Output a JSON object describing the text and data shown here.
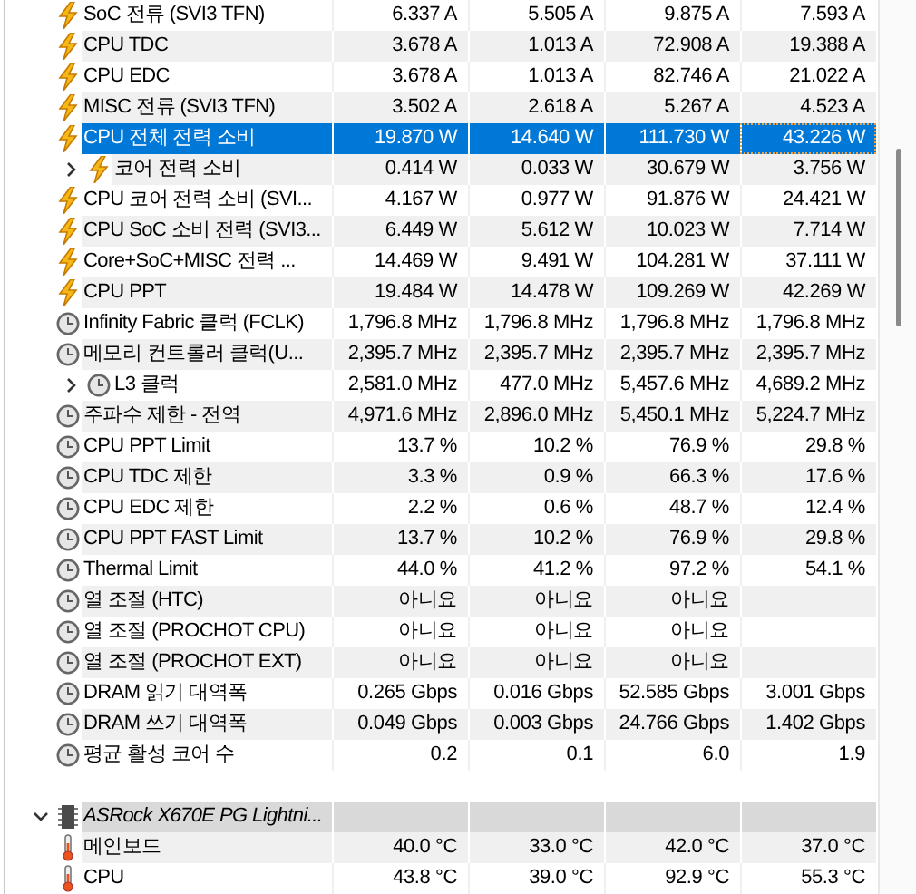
{
  "rows": [
    {
      "kind": "power",
      "name": "SoC 전류 (SVI3 TFN)",
      "selected": false,
      "values": [
        "6.337 A",
        "5.505 A",
        "9.875 A",
        "7.593 A"
      ]
    },
    {
      "kind": "power",
      "name": "CPU TDC",
      "selected": false,
      "values": [
        "3.678 A",
        "1.013 A",
        "72.908 A",
        "19.388 A"
      ]
    },
    {
      "kind": "power",
      "name": "CPU EDC",
      "selected": false,
      "values": [
        "3.678 A",
        "1.013 A",
        "82.746 A",
        "21.022 A"
      ]
    },
    {
      "kind": "power",
      "name": "MISC 전류 (SVI3 TFN)",
      "selected": false,
      "values": [
        "3.502 A",
        "2.618 A",
        "5.267 A",
        "4.523 A"
      ]
    },
    {
      "kind": "power",
      "name": "CPU 전체 전력 소비",
      "selected": true,
      "values": [
        "19.870 W",
        "14.640 W",
        "111.730 W",
        "43.226 W"
      ]
    },
    {
      "kind": "power",
      "name": "코어 전력 소비",
      "selected": false,
      "expanded": false,
      "values": [
        "0.414 W",
        "0.033 W",
        "30.679 W",
        "3.756 W"
      ]
    },
    {
      "kind": "power",
      "name": "CPU 코어 전력 소비 (SVI...",
      "selected": false,
      "values": [
        "4.167 W",
        "0.977 W",
        "91.876 W",
        "24.421 W"
      ]
    },
    {
      "kind": "power",
      "name": "CPU SoC 소비 전력 (SVI3...",
      "selected": false,
      "values": [
        "6.449 W",
        "5.612 W",
        "10.023 W",
        "7.714 W"
      ]
    },
    {
      "kind": "power",
      "name": "Core+SoC+MISC 전력 ...",
      "selected": false,
      "values": [
        "14.469 W",
        "9.491 W",
        "104.281 W",
        "37.111 W"
      ]
    },
    {
      "kind": "power",
      "name": "CPU PPT",
      "selected": false,
      "values": [
        "19.484 W",
        "14.478 W",
        "109.269 W",
        "42.269 W"
      ]
    },
    {
      "kind": "clock",
      "name": "Infinity Fabric 클럭 (FCLK)",
      "selected": false,
      "values": [
        "1,796.8 MHz",
        "1,796.8 MHz",
        "1,796.8 MHz",
        "1,796.8 MHz"
      ]
    },
    {
      "kind": "clock",
      "name": "메모리 컨트롤러 클럭(U...",
      "selected": false,
      "values": [
        "2,395.7 MHz",
        "2,395.7 MHz",
        "2,395.7 MHz",
        "2,395.7 MHz"
      ]
    },
    {
      "kind": "clock",
      "name": "L3 클럭",
      "selected": false,
      "expanded": false,
      "values": [
        "2,581.0 MHz",
        "477.0 MHz",
        "5,457.6 MHz",
        "4,689.2 MHz"
      ]
    },
    {
      "kind": "clock",
      "name": "주파수 제한 - 전역",
      "selected": false,
      "values": [
        "4,971.6 MHz",
        "2,896.0 MHz",
        "5,450.1 MHz",
        "5,224.7 MHz"
      ]
    },
    {
      "kind": "clock",
      "name": "CPU PPT Limit",
      "selected": false,
      "values": [
        "13.7 %",
        "10.2 %",
        "76.9 %",
        "29.8 %"
      ]
    },
    {
      "kind": "clock",
      "name": "CPU TDC 제한",
      "selected": false,
      "values": [
        "3.3 %",
        "0.9 %",
        "66.3 %",
        "17.6 %"
      ]
    },
    {
      "kind": "clock",
      "name": "CPU EDC 제한",
      "selected": false,
      "values": [
        "2.2 %",
        "0.6 %",
        "48.7 %",
        "12.4 %"
      ]
    },
    {
      "kind": "clock",
      "name": "CPU PPT FAST Limit",
      "selected": false,
      "values": [
        "13.7 %",
        "10.2 %",
        "76.9 %",
        "29.8 %"
      ]
    },
    {
      "kind": "clock",
      "name": "Thermal Limit",
      "selected": false,
      "values": [
        "44.0 %",
        "41.2 %",
        "97.2 %",
        "54.1 %"
      ]
    },
    {
      "kind": "clock",
      "name": "열 조절 (HTC)",
      "selected": false,
      "values": [
        "아니요",
        "아니요",
        "아니요"
      ]
    },
    {
      "kind": "clock",
      "name": "열 조절 (PROCHOT CPU)",
      "selected": false,
      "values": [
        "아니요",
        "아니요",
        "아니요"
      ]
    },
    {
      "kind": "clock",
      "name": "열 조절 (PROCHOT EXT)",
      "selected": false,
      "values": [
        "아니요",
        "아니요",
        "아니요"
      ]
    },
    {
      "kind": "clock",
      "name": "DRAM 읽기 대역폭",
      "selected": false,
      "values": [
        "0.265 Gbps",
        "0.016 Gbps",
        "52.585 Gbps",
        "3.001 Gbps"
      ]
    },
    {
      "kind": "clock",
      "name": "DRAM 쓰기 대역폭",
      "selected": false,
      "values": [
        "0.049 Gbps",
        "0.003 Gbps",
        "24.766 Gbps",
        "1.402 Gbps"
      ]
    },
    {
      "kind": "clock",
      "name": "평균 활성 코어 수",
      "selected": false,
      "values": [
        "0.2",
        "0.1",
        "6.0",
        "1.9"
      ]
    },
    {
      "kind": "spacer"
    },
    {
      "kind": "group",
      "name": "ASRock X670E PG Lightni...",
      "selected": false,
      "expanded": true,
      "children": [
        {
          "kind": "temperature",
          "name": "메인보드",
          "selected": false,
          "values": [
            "40.0 °C",
            "33.0 °C",
            "42.0 °C",
            "37.0 °C"
          ]
        },
        {
          "kind": "temperature",
          "name": "CPU",
          "selected": false,
          "values": [
            "43.8 °C",
            "39.0 °C",
            "92.9 °C",
            "55.3 °C"
          ]
        }
      ]
    }
  ]
}
